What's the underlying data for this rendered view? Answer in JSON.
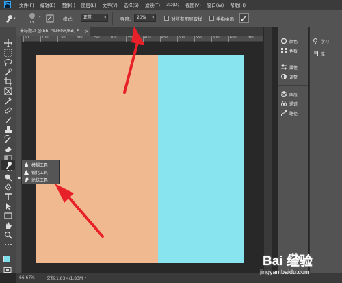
{
  "app": {
    "logo_text": "Ps"
  },
  "menu": [
    "文件(F)",
    "编辑(E)",
    "图像(I)",
    "图层(L)",
    "文字(Y)",
    "选择(S)",
    "滤镜(T)",
    "3D(D)",
    "视图(V)",
    "窗口(W)",
    "帮助(H)"
  ],
  "options": {
    "brush_size": "13",
    "mode_label": "模式:",
    "mode_value": "正常",
    "strength_label": "强度:",
    "strength_value": "20%",
    "sample_all_layers": "对所有图层取样",
    "finger_painting": "手指绘画"
  },
  "document": {
    "tab_title": "未标题-1 @ 66.7%(RGB/8#) *",
    "close": "×",
    "ruler_ticks": [
      "50",
      "100",
      "150",
      "200",
      "250",
      "300",
      "350",
      "400",
      "450",
      "500",
      "550",
      "600",
      "650",
      "700"
    ]
  },
  "canvas": {
    "left_color": "#f0b990",
    "right_color": "#88e5ef",
    "split_fraction": 0.59
  },
  "flyout": {
    "items": [
      "模糊工具",
      "锐化工具",
      "涂抹工具"
    ]
  },
  "panels": {
    "col1": [
      "颜色",
      "色板",
      "属性",
      "调整",
      "图层",
      "通道",
      "路径"
    ],
    "col2": [
      "学习",
      "库"
    ]
  },
  "status": {
    "zoom": "66.67%",
    "doc": "文档:1.83M/1.83M"
  },
  "watermark": {
    "logo": "Bai 经验",
    "url": "jingyan.baidu.com"
  },
  "colors": {
    "accent": "#31a8ff",
    "arrow": "#e8202a"
  }
}
